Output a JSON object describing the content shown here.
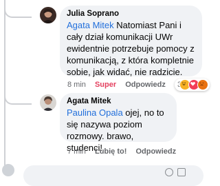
{
  "comments": [
    {
      "author": "Julia Soprano",
      "mention": "Agata Mitek",
      "text": " Natomiast Pani i cały dział komunikacji UWr ewidentnie potrzebuje pomocy z komunikacją, z która kompletnie sobie, jak widać, nie radzicie.",
      "time": "8 min",
      "reaction_label": "Super",
      "reply_label": "Odpowiedz",
      "reaction_count": "3",
      "reaction_icons": [
        "haha-icon",
        "love-icon",
        "angry-icon"
      ],
      "colors": {
        "reaction": "#e4405f"
      }
    },
    {
      "author": "Agata Mitek",
      "mention": "Paulina Opala",
      "text": " ojej, no to się nazywa poziom rozmowy. brawo, studenci!",
      "time": "7 min",
      "like_label": "Lubię to!",
      "reply_label": "Odpowiedz"
    }
  ],
  "colors": {
    "mention": "#216fdb",
    "bubble": "#f0f2f5",
    "meta": "#65676b"
  }
}
